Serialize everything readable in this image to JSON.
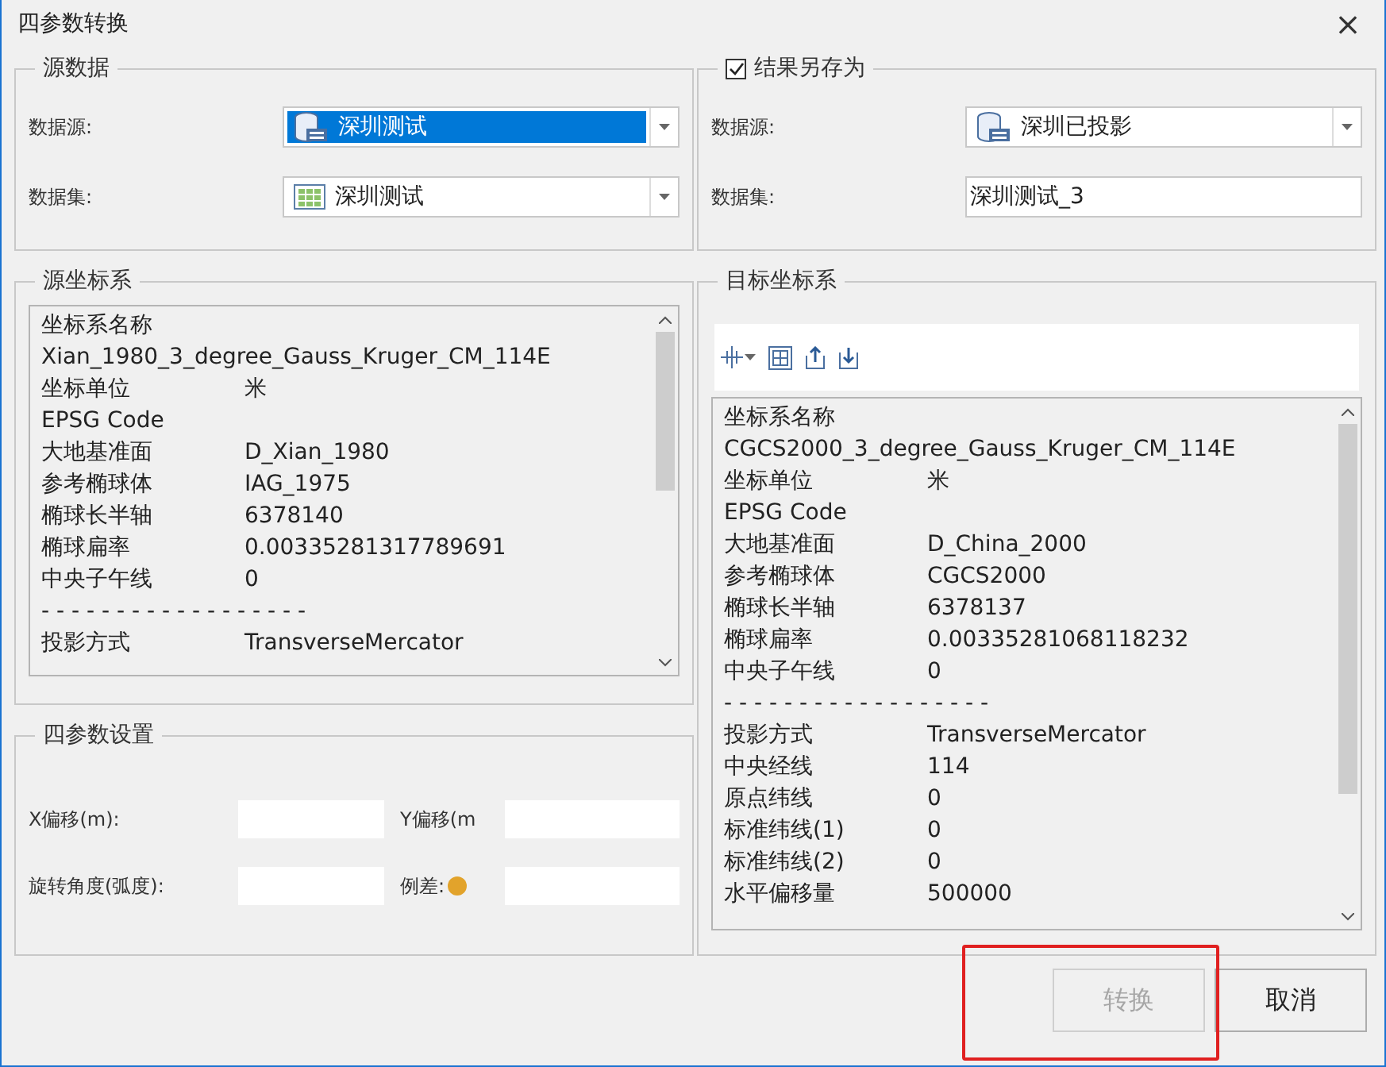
{
  "window": {
    "title": "四参数转换",
    "close": "×"
  },
  "source_data": {
    "title": "源数据",
    "fields": [
      {
        "label": "数据源:",
        "value": "深圳测试",
        "selected": true
      },
      {
        "label": "数据集:",
        "value": "深圳测试",
        "selected": false
      }
    ]
  },
  "save_result": {
    "title": "结果另存为",
    "checked": true,
    "fields": [
      {
        "label": "数据源:",
        "value": "深圳已投影",
        "kind": "combo"
      },
      {
        "label": "数据集:",
        "value": "深圳测试_3",
        "kind": "text"
      }
    ]
  },
  "source_crs": {
    "title": "源坐标系",
    "rows": [
      {
        "label": "坐标系名称"
      },
      {
        "label": "Xian_1980_3_degree_Gauss_Kruger_CM_114E"
      },
      {
        "label": "坐标单位",
        "value": "米"
      },
      {
        "label": "EPSG Code"
      },
      {
        "label": "大地基准面",
        "value": "D_Xian_1980"
      },
      {
        "label": "参考椭球体",
        "value": "IAG_1975"
      },
      {
        "label": "椭球长半轴",
        "value": "6378140"
      },
      {
        "label": "椭球扁率",
        "value": "0.00335281317789691"
      },
      {
        "label": "中央子午线",
        "value": "0"
      },
      {
        "label": "- - - - - - - - - - - - - - - - - -"
      },
      {
        "label": "投影方式",
        "value": "TransverseMercator"
      }
    ]
  },
  "target_crs": {
    "title": "目标坐标系",
    "rows": [
      {
        "label": "坐标系名称"
      },
      {
        "label": "CGCS2000_3_degree_Gauss_Kruger_CM_114E"
      },
      {
        "label": "坐标单位",
        "value": "米"
      },
      {
        "label": "EPSG Code"
      },
      {
        "label": "大地基准面",
        "value": "D_China_2000"
      },
      {
        "label": "参考椭球体",
        "value": "CGCS2000"
      },
      {
        "label": "椭球长半轴",
        "value": "6378137"
      },
      {
        "label": "椭球扁率",
        "value": "0.00335281068118232"
      },
      {
        "label": "中央子午线",
        "value": "0"
      },
      {
        "label": "- - - - - - - - - - - - - - - - - -"
      },
      {
        "label": "投影方式",
        "value": "TransverseMercator"
      },
      {
        "label": "中央经线",
        "value": "114"
      },
      {
        "label": "原点纬线",
        "value": "0"
      },
      {
        "label": "标准纬线(1)",
        "value": "0"
      },
      {
        "label": "标准纬线(2)",
        "value": "0"
      },
      {
        "label": "水平偏移量",
        "value": "500000"
      }
    ]
  },
  "four_params": {
    "title": "四参数设置",
    "fields": [
      {
        "label": "X偏移(m):"
      },
      {
        "label": "Y偏移(m"
      },
      {
        "label": "旋转角度(弧度):"
      },
      {
        "label": "例差:"
      }
    ]
  },
  "buttons": [
    {
      "label": "转换",
      "disabled": true
    },
    {
      "label": "取消",
      "disabled": false
    }
  ]
}
